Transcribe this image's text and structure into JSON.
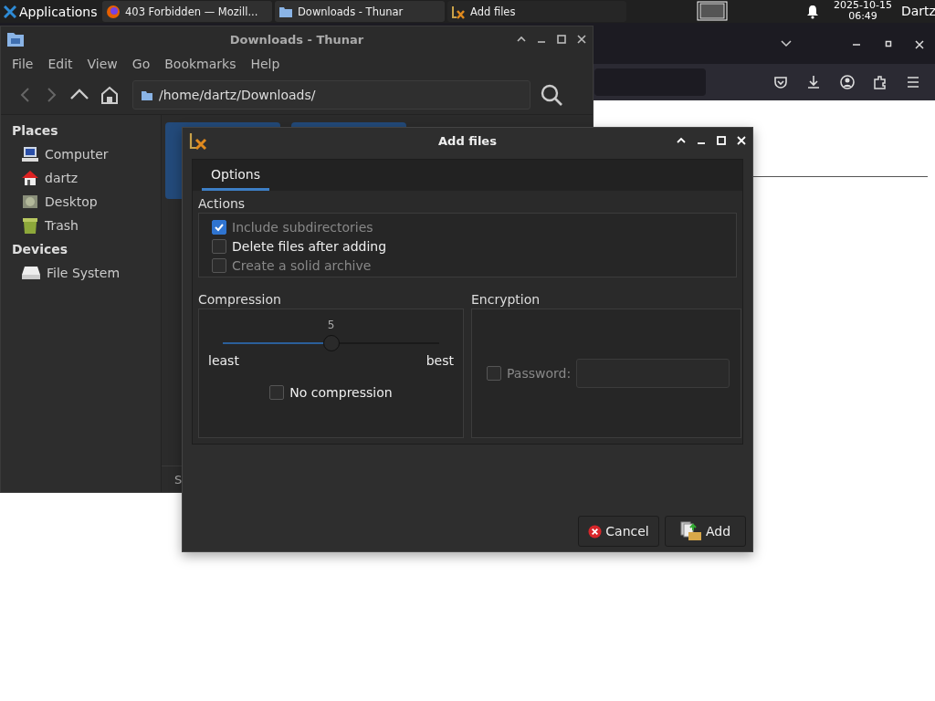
{
  "taskbar": {
    "menu_label": "Applications",
    "tasks": [
      {
        "label": "403 Forbidden — Mozill...",
        "selected": false
      },
      {
        "label": "Downloads - Thunar",
        "selected": false
      },
      {
        "label": "Add files",
        "selected": true
      }
    ],
    "date": "2025-10-15",
    "time": "06:49",
    "user": "Dartz"
  },
  "file_manager": {
    "title": "Downloads - Thunar",
    "menu": [
      "File",
      "Edit",
      "View",
      "Go",
      "Bookmarks",
      "Help"
    ],
    "path": "/home/dartz/Downloads/",
    "sidebar": [
      {
        "heading": "Places",
        "items": [
          {
            "label": "Computer"
          },
          {
            "label": "dartz"
          },
          {
            "label": "Desktop"
          },
          {
            "label": "Trash"
          }
        ]
      },
      {
        "heading": "Devices",
        "items": [
          {
            "label": "File System"
          }
        ]
      }
    ],
    "status": "S"
  },
  "dialog": {
    "title": "Add files",
    "tabs": [
      {
        "label": "Options",
        "selected": true
      }
    ],
    "actions": {
      "title": "Actions",
      "options": [
        {
          "label": "Include subdirectories",
          "checked": true,
          "disabled": true
        },
        {
          "label": "Delete files after adding",
          "checked": false,
          "disabled": false
        },
        {
          "label": "Create a solid archive",
          "checked": false,
          "disabled": true
        }
      ]
    },
    "compression": {
      "title": "Compression",
      "value": "5",
      "level": 0.5,
      "min_label": "least",
      "max_label": "best",
      "no_compression": {
        "label": "No compression",
        "checked": false
      }
    },
    "encryption": {
      "title": "Encryption",
      "password": {
        "label": "Password:",
        "checked": false,
        "disabled": true
      }
    },
    "buttons": [
      {
        "label": "Cancel",
        "kind": "cancel"
      },
      {
        "label": "Add",
        "kind": "add"
      }
    ]
  }
}
